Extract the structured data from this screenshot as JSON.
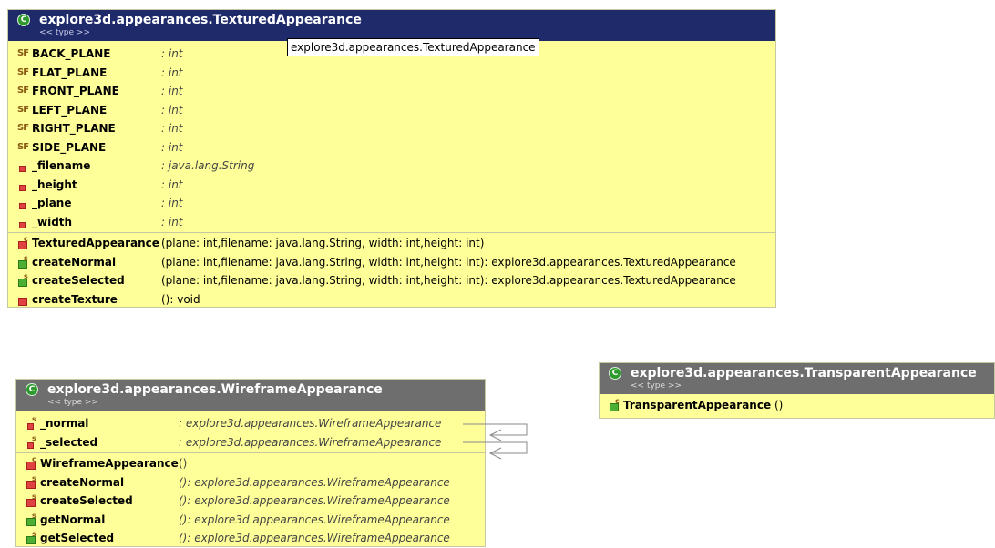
{
  "tooltip": "explore3d.appearances.TexturedAppearance",
  "textured": {
    "name": "explore3d.appearances.TexturedAppearance",
    "stereotype": "<< type >>",
    "fields": [
      {
        "name": "BACK_PLANE",
        "type": ": int",
        "kind": "static-final"
      },
      {
        "name": "FLAT_PLANE",
        "type": ": int",
        "kind": "static-final"
      },
      {
        "name": "FRONT_PLANE",
        "type": ": int",
        "kind": "static-final"
      },
      {
        "name": "LEFT_PLANE",
        "type": ": int",
        "kind": "static-final"
      },
      {
        "name": "RIGHT_PLANE",
        "type": ": int",
        "kind": "static-final"
      },
      {
        "name": "SIDE_PLANE",
        "type": ": int",
        "kind": "static-final"
      },
      {
        "name": "_filename",
        "type": ": java.lang.String",
        "kind": "private"
      },
      {
        "name": "_height",
        "type": ": int",
        "kind": "private"
      },
      {
        "name": "_plane",
        "type": ": int",
        "kind": "private"
      },
      {
        "name": "_width",
        "type": ": int",
        "kind": "private"
      }
    ],
    "methods": [
      {
        "name": "TexturedAppearance",
        "sig": "(plane: int,filename: java.lang.String,  width: int,height: int)",
        "kind": "public-constructor"
      },
      {
        "name": "createNormal",
        "sig": "(plane: int,filename: java.lang.String,  width: int,height: int): explore3d.appearances.TexturedAppearance",
        "kind": "public-static"
      },
      {
        "name": "createSelected",
        "sig": "(plane: int,filename: java.lang.String,  width: int,height: int): explore3d.appearances.TexturedAppearance",
        "kind": "public-static"
      },
      {
        "name": "createTexture",
        "sig": "(): void",
        "kind": "private"
      }
    ]
  },
  "wireframe": {
    "name": "explore3d.appearances.WireframeAppearance",
    "stereotype": "<< type >>",
    "fields": [
      {
        "name": "_normal",
        "type": ": explore3d.appearances.WireframeAppearance",
        "kind": "private-static"
      },
      {
        "name": "_selected",
        "type": ": explore3d.appearances.WireframeAppearance",
        "kind": "private-static"
      }
    ],
    "methods": [
      {
        "name": "WireframeAppearance",
        "sig": "()",
        "kind": "private-constructor"
      },
      {
        "name": "createNormal",
        "sig": "(): explore3d.appearances.WireframeAppearance",
        "kind": "private-static"
      },
      {
        "name": "createSelected",
        "sig": "(): explore3d.appearances.WireframeAppearance",
        "kind": "private-static"
      },
      {
        "name": "getNormal",
        "sig": "(): explore3d.appearances.WireframeAppearance",
        "kind": "public-static"
      },
      {
        "name": "getSelected",
        "sig": "(): explore3d.appearances.WireframeAppearance",
        "kind": "public-static"
      }
    ]
  },
  "transparent": {
    "name": "explore3d.appearances.TransparentAppearance",
    "stereotype": "<< type >>",
    "methods": [
      {
        "name": "TransparentAppearance",
        "sig": "()",
        "kind": "public-constructor"
      }
    ]
  }
}
